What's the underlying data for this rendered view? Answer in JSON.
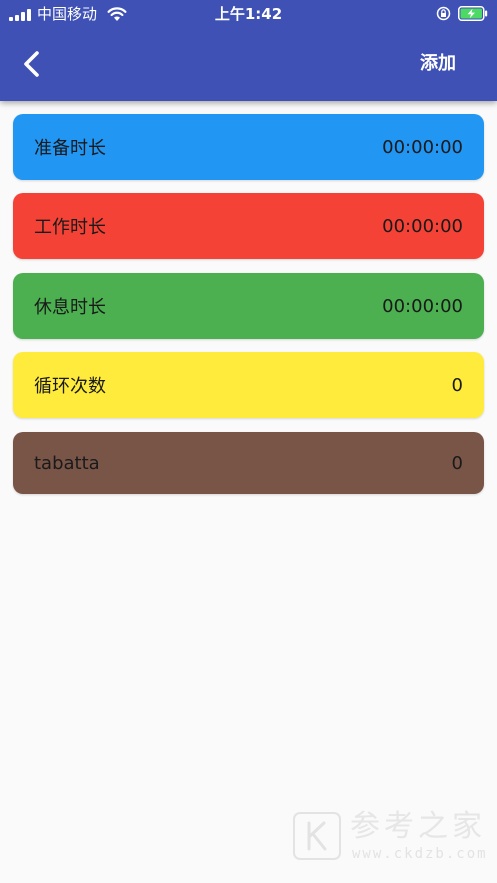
{
  "status_bar": {
    "carrier": "中国移动",
    "time": "上午1:42"
  },
  "header": {
    "back_icon": "chevron-left-icon",
    "add_label": "添加"
  },
  "cards": [
    {
      "label": "准备时长",
      "value": "00:00:00",
      "color": "#2196f3"
    },
    {
      "label": "工作时长",
      "value": "00:00:00",
      "color": "#f44336"
    },
    {
      "label": "休息时长",
      "value": "00:00:00",
      "color": "#4caf50"
    },
    {
      "label": "循环次数",
      "value": "0",
      "color": "#ffeb3b"
    },
    {
      "label": "tabatta",
      "value": "0",
      "color": "#795548"
    }
  ],
  "watermark": {
    "title": "参考之家",
    "url": "www.ckdzb.com"
  },
  "colors": {
    "app_bar": "#3f51b5",
    "background": "#fafafa",
    "battery_fill": "#4cd964"
  }
}
